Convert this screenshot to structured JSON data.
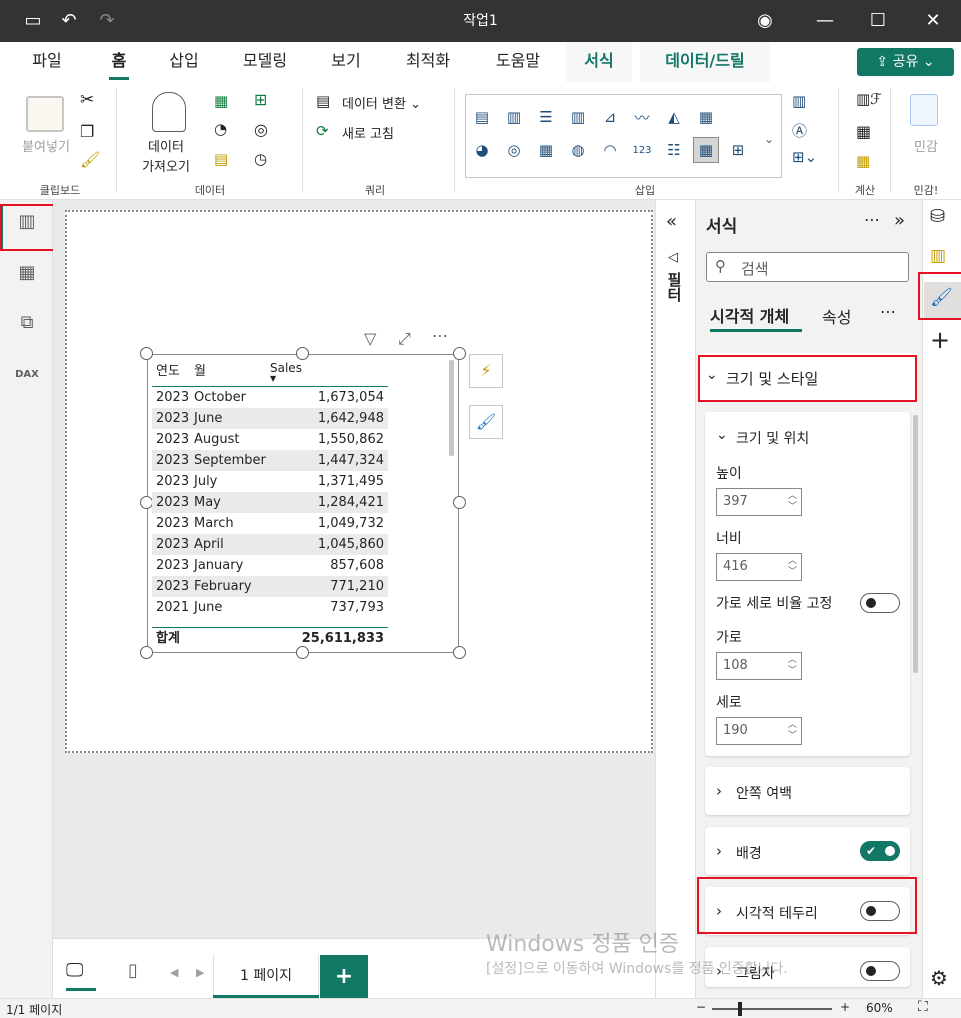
{
  "window": {
    "title": "작업1"
  },
  "menu": {
    "tabs": [
      {
        "label": "파일"
      },
      {
        "label": "홈"
      },
      {
        "label": "삽입"
      },
      {
        "label": "모델링"
      },
      {
        "label": "보기"
      },
      {
        "label": "최적화"
      },
      {
        "label": "도움말"
      },
      {
        "label": "서식"
      },
      {
        "label": "데이터/드릴"
      }
    ],
    "share_label": "공유"
  },
  "ribbon": {
    "clipboard": {
      "paste_label": "붙여넣기",
      "group_label": "클립보드"
    },
    "data": {
      "get_data_label1": "데이터",
      "get_data_label2": "가져오기",
      "group_label": "데이터"
    },
    "query": {
      "transform_label": "데이터 변환",
      "refresh_label": "새로 고침",
      "group_label": "쿼리"
    },
    "insert": {
      "group_label": "삽입"
    },
    "calc": {
      "group_label": "계산"
    },
    "sensitivity": {
      "label": "민감",
      "group_label": "민감!"
    }
  },
  "table": {
    "headers": {
      "year": "연도",
      "month": "월",
      "sales": "Sales"
    },
    "rows": [
      {
        "year": "2023",
        "month": "October",
        "sales": "1,673,054"
      },
      {
        "year": "2023",
        "month": "June",
        "sales": "1,642,948"
      },
      {
        "year": "2023",
        "month": "August",
        "sales": "1,550,862"
      },
      {
        "year": "2023",
        "month": "September",
        "sales": "1,447,324"
      },
      {
        "year": "2023",
        "month": "July",
        "sales": "1,371,495"
      },
      {
        "year": "2023",
        "month": "May",
        "sales": "1,284,421"
      },
      {
        "year": "2023",
        "month": "March",
        "sales": "1,049,732"
      },
      {
        "year": "2023",
        "month": "April",
        "sales": "1,045,860"
      },
      {
        "year": "2023",
        "month": "January",
        "sales": "857,608"
      },
      {
        "year": "2023",
        "month": "February",
        "sales": "771,210"
      },
      {
        "year": "2021",
        "month": "June",
        "sales": "737,793"
      }
    ],
    "total_label": "합계",
    "total_value": "25,611,833"
  },
  "filter_pane": {
    "label": "필터"
  },
  "format_pane": {
    "title": "서식",
    "search_placeholder": "검색",
    "tabs": {
      "visual": "시각적 개체",
      "props": "속성"
    },
    "size_style": "크기 및 스타일",
    "size_position": "크기 및 위치",
    "height_label": "높이",
    "height_value": "397",
    "width_label": "너비",
    "width_value": "416",
    "lock_ratio_label": "가로 세로 비율 고정",
    "x_label": "가로",
    "x_value": "108",
    "y_label": "세로",
    "y_value": "190",
    "padding": "안쪽 여백",
    "background": "배경",
    "visual_border": "시각적 테두리",
    "shadow": "그림자"
  },
  "pages": {
    "page1": "1 페이지"
  },
  "status": {
    "page_count": "1/1 페이지",
    "zoom": "60%"
  },
  "watermark": {
    "line1": "Windows 정품 인증",
    "line2": "[설정]으로 이동하여 Windows를 정품 인증합니다."
  },
  "colors": {
    "accent": "#117865",
    "highlight": "#e81123",
    "titlebar": "#333333"
  }
}
